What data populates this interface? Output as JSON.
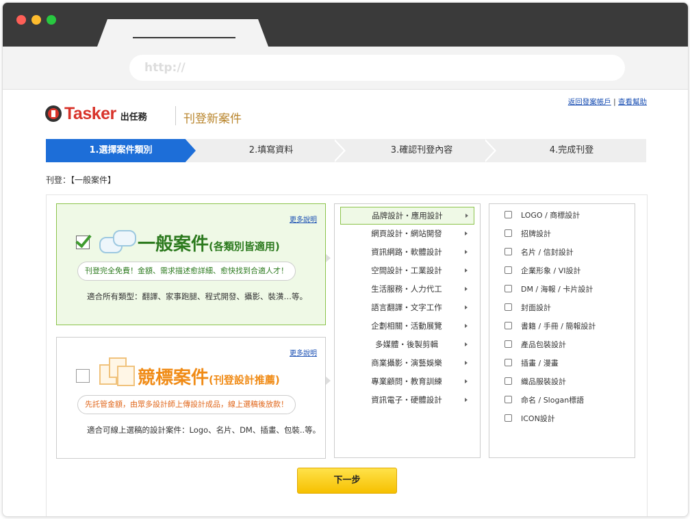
{
  "browser": {
    "url_placeholder": "http://"
  },
  "header": {
    "logo_name": "Tasker",
    "logo_sub": "出任務",
    "page_title": "刊登新案件",
    "link_account": "返回發案帳戶",
    "link_separator": "|",
    "link_help": "查看幫助"
  },
  "steps": [
    "1.選擇案件類別",
    "2.填寫資料",
    "3.確認刊登內容",
    "4.完成刊登"
  ],
  "breadcrumb": "刊登：【一般案件】",
  "cards": {
    "general": {
      "more": "更多說明",
      "title": "一般案件",
      "subtitle": "(各類別皆適用)",
      "pill": "刊登完全免費！金額、需求描述愈詳細、愈快找到合適人才！",
      "desc": "適合所有類型：翻譯、家事跑腿、程式開發、攝影、裝潢…等。",
      "checked": true
    },
    "competition": {
      "more": "更多說明",
      "title": "競標案件",
      "subtitle": "(刊登設計推薦)",
      "pill": "先託管金額，由眾多設計師上傳設計成品，線上選稿後放款！",
      "desc": "適合可線上選稿的設計案件：Logo、名片、DM、插畫、包裝..等。",
      "checked": false
    }
  },
  "categories": [
    "品牌設計・應用設計",
    "網頁設計・網站開發",
    "資訊網路・軟體設計",
    "空間設計・工業設計",
    "生活服務・人力代工",
    "語言翻譯・文字工作",
    "企劃相關・活動展覽",
    "多媒體・後製剪輯",
    "商業攝影・演藝娛樂",
    "專業顧問・教育訓練",
    "資訊電子・硬體設計"
  ],
  "selected_category_index": 0,
  "subcategories": [
    "LOGO / 商標設計",
    "招牌設計",
    "名片 / 信封設計",
    "企業形象 / VI設計",
    "DM / 海報 / 卡片設計",
    "封面設計",
    "書籍 / 手冊 / 簡報設計",
    "產品包裝設計",
    "插畫 / 漫畫",
    "織品服裝設計",
    "命名 / Slogan標語",
    "ICON設計"
  ],
  "next_button": "下一步",
  "colors": {
    "step_active": "#1d6ed8",
    "brand_red": "#d8332a",
    "green": "#2c7a1e",
    "orange": "#f08b16",
    "button": "#f6c000"
  }
}
